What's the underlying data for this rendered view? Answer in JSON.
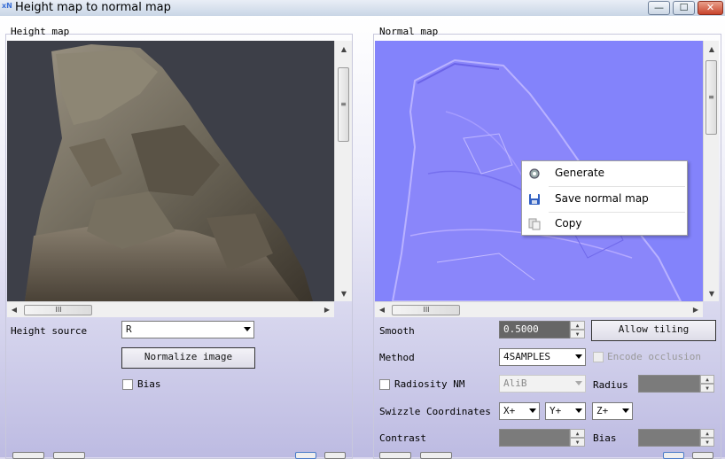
{
  "window": {
    "logo": "xN",
    "title": "Height map to normal map",
    "minimize_glyph": "—",
    "maximize_glyph": "☐",
    "close_glyph": "✕"
  },
  "left_panel": {
    "label": "Height map",
    "height_source_label": "Height source",
    "height_source_value": "R",
    "normalize_button": "Normalize image",
    "bias_label": "Bias",
    "hscroll_grip": "III",
    "vscroll_grip": "≡"
  },
  "right_panel": {
    "label": "Normal map",
    "smooth_label": "Smooth",
    "smooth_value": "0.5000",
    "allow_tiling_button": "Allow tiling",
    "method_label": "Method",
    "method_value": "4SAMPLES",
    "encode_occlusion_label": "Encode occlusion",
    "radiosity_label": "Radiosity NM",
    "radiosity_value": "AliB",
    "radius_label": "Radius",
    "swizzle_label": "Swizzle Coordinates",
    "swizzle_x": "X+",
    "swizzle_y": "Y+",
    "swizzle_z": "Z+",
    "contrast_label": "Contrast",
    "bias_label": "Bias",
    "hscroll_grip": "III",
    "vscroll_grip": "≡"
  },
  "context_menu": {
    "items": [
      {
        "label": "Generate",
        "icon": "gear-icon"
      },
      {
        "label": "Save normal map",
        "icon": "floppy-disk-icon"
      },
      {
        "label": "Copy",
        "icon": "copy-icon"
      }
    ]
  },
  "colors": {
    "normal_map_base": "#8080ff",
    "title_bar": "#c9d6e6",
    "close_button": "#c8442c"
  }
}
